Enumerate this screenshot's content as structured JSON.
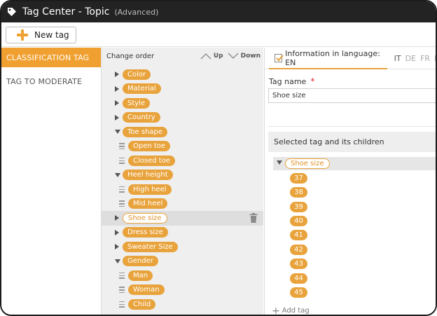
{
  "window": {
    "title": "Tag Center - Topic",
    "subtitle": "(Advanced)",
    "icon": "tag-icon"
  },
  "toolbar": {
    "new_tag_label": "New tag",
    "icon": "plus-icon"
  },
  "sidebar": {
    "items": [
      {
        "label": "CLASSIFICATION TAG",
        "active": true
      },
      {
        "label": "TAG TO MODERATE",
        "active": false
      }
    ]
  },
  "tree_header": {
    "label": "Change order",
    "up_label": "Up",
    "down_label": "Down"
  },
  "tree": [
    {
      "label": "Color"
    },
    {
      "label": "Material"
    },
    {
      "label": "Style"
    },
    {
      "label": "Country"
    },
    {
      "label": "Toe shape"
    },
    {
      "label": "Open toe"
    },
    {
      "label": "Closed toe"
    },
    {
      "label": "Heel height"
    },
    {
      "label": "High heel"
    },
    {
      "label": "Mid heel"
    },
    {
      "label": "Shoe size"
    },
    {
      "label": "Dress size"
    },
    {
      "label": "Sweater Size"
    },
    {
      "label": "Gender"
    },
    {
      "label": "Man"
    },
    {
      "label": "Woman"
    },
    {
      "label": "Child"
    }
  ],
  "language": {
    "active_label": "Information in language: EN",
    "others": [
      "IT",
      "DE",
      "FR",
      "E"
    ]
  },
  "form": {
    "tag_name_label": "Tag name",
    "required_mark": "*",
    "tag_name_value": "Shoe size"
  },
  "selected": {
    "header": "Selected tag and its children",
    "root": "Shoe size",
    "children": [
      "37",
      "38",
      "39",
      "40",
      "41",
      "42",
      "43",
      "44",
      "45"
    ],
    "add_label": "Add tag"
  },
  "colors": {
    "accent": "#e9a33c",
    "titlebar": "#232323"
  }
}
